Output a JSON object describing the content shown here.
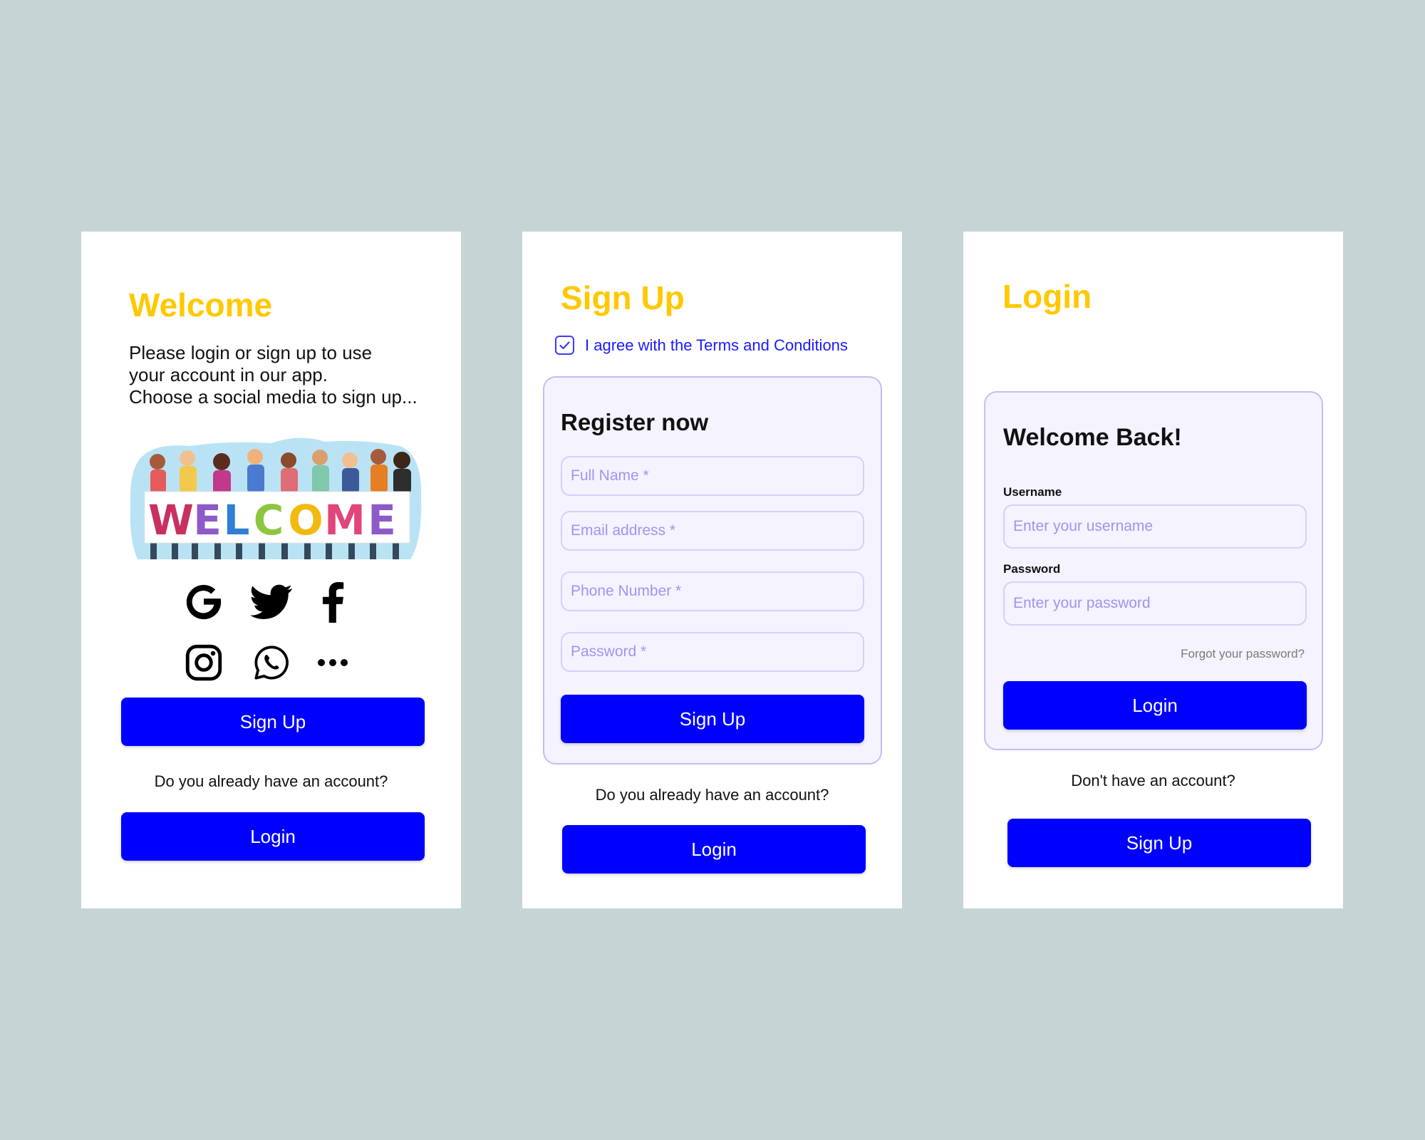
{
  "colors": {
    "background": "#c5d5d6",
    "title_accent": "#ffc800",
    "primary_button": "#0000ff",
    "card_background": "#f4f3ff",
    "card_border": "#c4bdf6",
    "placeholder": "#a393f0",
    "link_text": "#1a1aff"
  },
  "welcome_screen": {
    "title": "Welcome",
    "intro_lines": [
      "Please login or sign up to use",
      "your account in our app.",
      "Choose a social media to sign up..."
    ],
    "illustration": {
      "banner_text": "WELCOME",
      "icon": "people-welcome-banner-illustration"
    },
    "social_icons": [
      "google-icon",
      "twitter-icon",
      "facebook-icon",
      "instagram-icon",
      "whatsapp-icon",
      "more-icon"
    ],
    "signup_button": "Sign Up",
    "account_prompt": "Do you already have an account?",
    "login_button": "Login"
  },
  "signup_screen": {
    "title": "Sign Up",
    "terms": {
      "label": "I agree with the Terms and Conditions",
      "checked": true
    },
    "form": {
      "heading": "Register now",
      "fields": [
        {
          "placeholder": "Full Name *"
        },
        {
          "placeholder": "Email address *"
        },
        {
          "placeholder": "Phone Number *"
        },
        {
          "placeholder": "Password *"
        }
      ],
      "submit_button": "Sign Up"
    },
    "account_prompt": "Do you already have an account?",
    "login_button": "Login"
  },
  "login_screen": {
    "title": "Login",
    "form": {
      "heading": "Welcome Back!",
      "username_label": "Username",
      "username_placeholder": "Enter your username",
      "password_label": "Password",
      "password_placeholder": "Enter your password",
      "forgot_link": "Forgot your password?",
      "submit_button": "Login"
    },
    "account_prompt": "Don't have an account?",
    "signup_button": "Sign Up"
  }
}
